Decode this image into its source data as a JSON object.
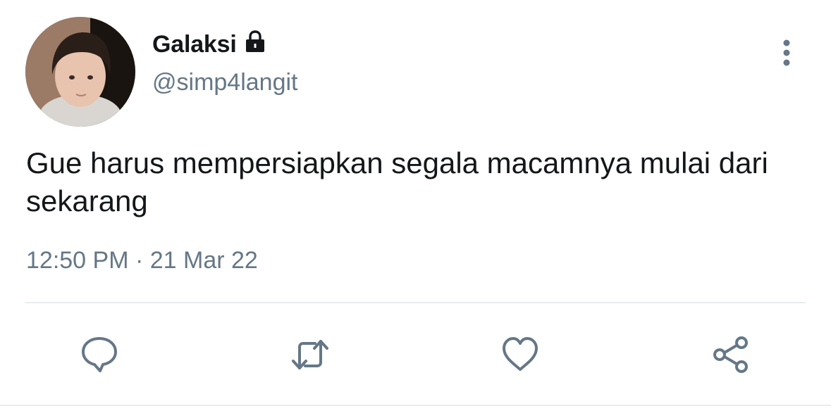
{
  "tweet": {
    "display_name": "Galaksi",
    "handle": "@simp4langit",
    "text": "Gue harus mempersiapkan segala macamnya mulai dari sekarang",
    "timestamp": "12:50 PM · 21 Mar 22",
    "protected_icon": "lock-icon",
    "more_icon": "more-vertical-icon"
  },
  "actions": [
    {
      "name": "reply",
      "icon": "reply-icon"
    },
    {
      "name": "retweet",
      "icon": "retweet-icon"
    },
    {
      "name": "like",
      "icon": "heart-icon"
    },
    {
      "name": "share",
      "icon": "share-icon"
    }
  ],
  "colors": {
    "primary_text": "#14171a",
    "secondary_text": "#657786",
    "divider": "#e6ecf0",
    "icon": "#657786"
  }
}
